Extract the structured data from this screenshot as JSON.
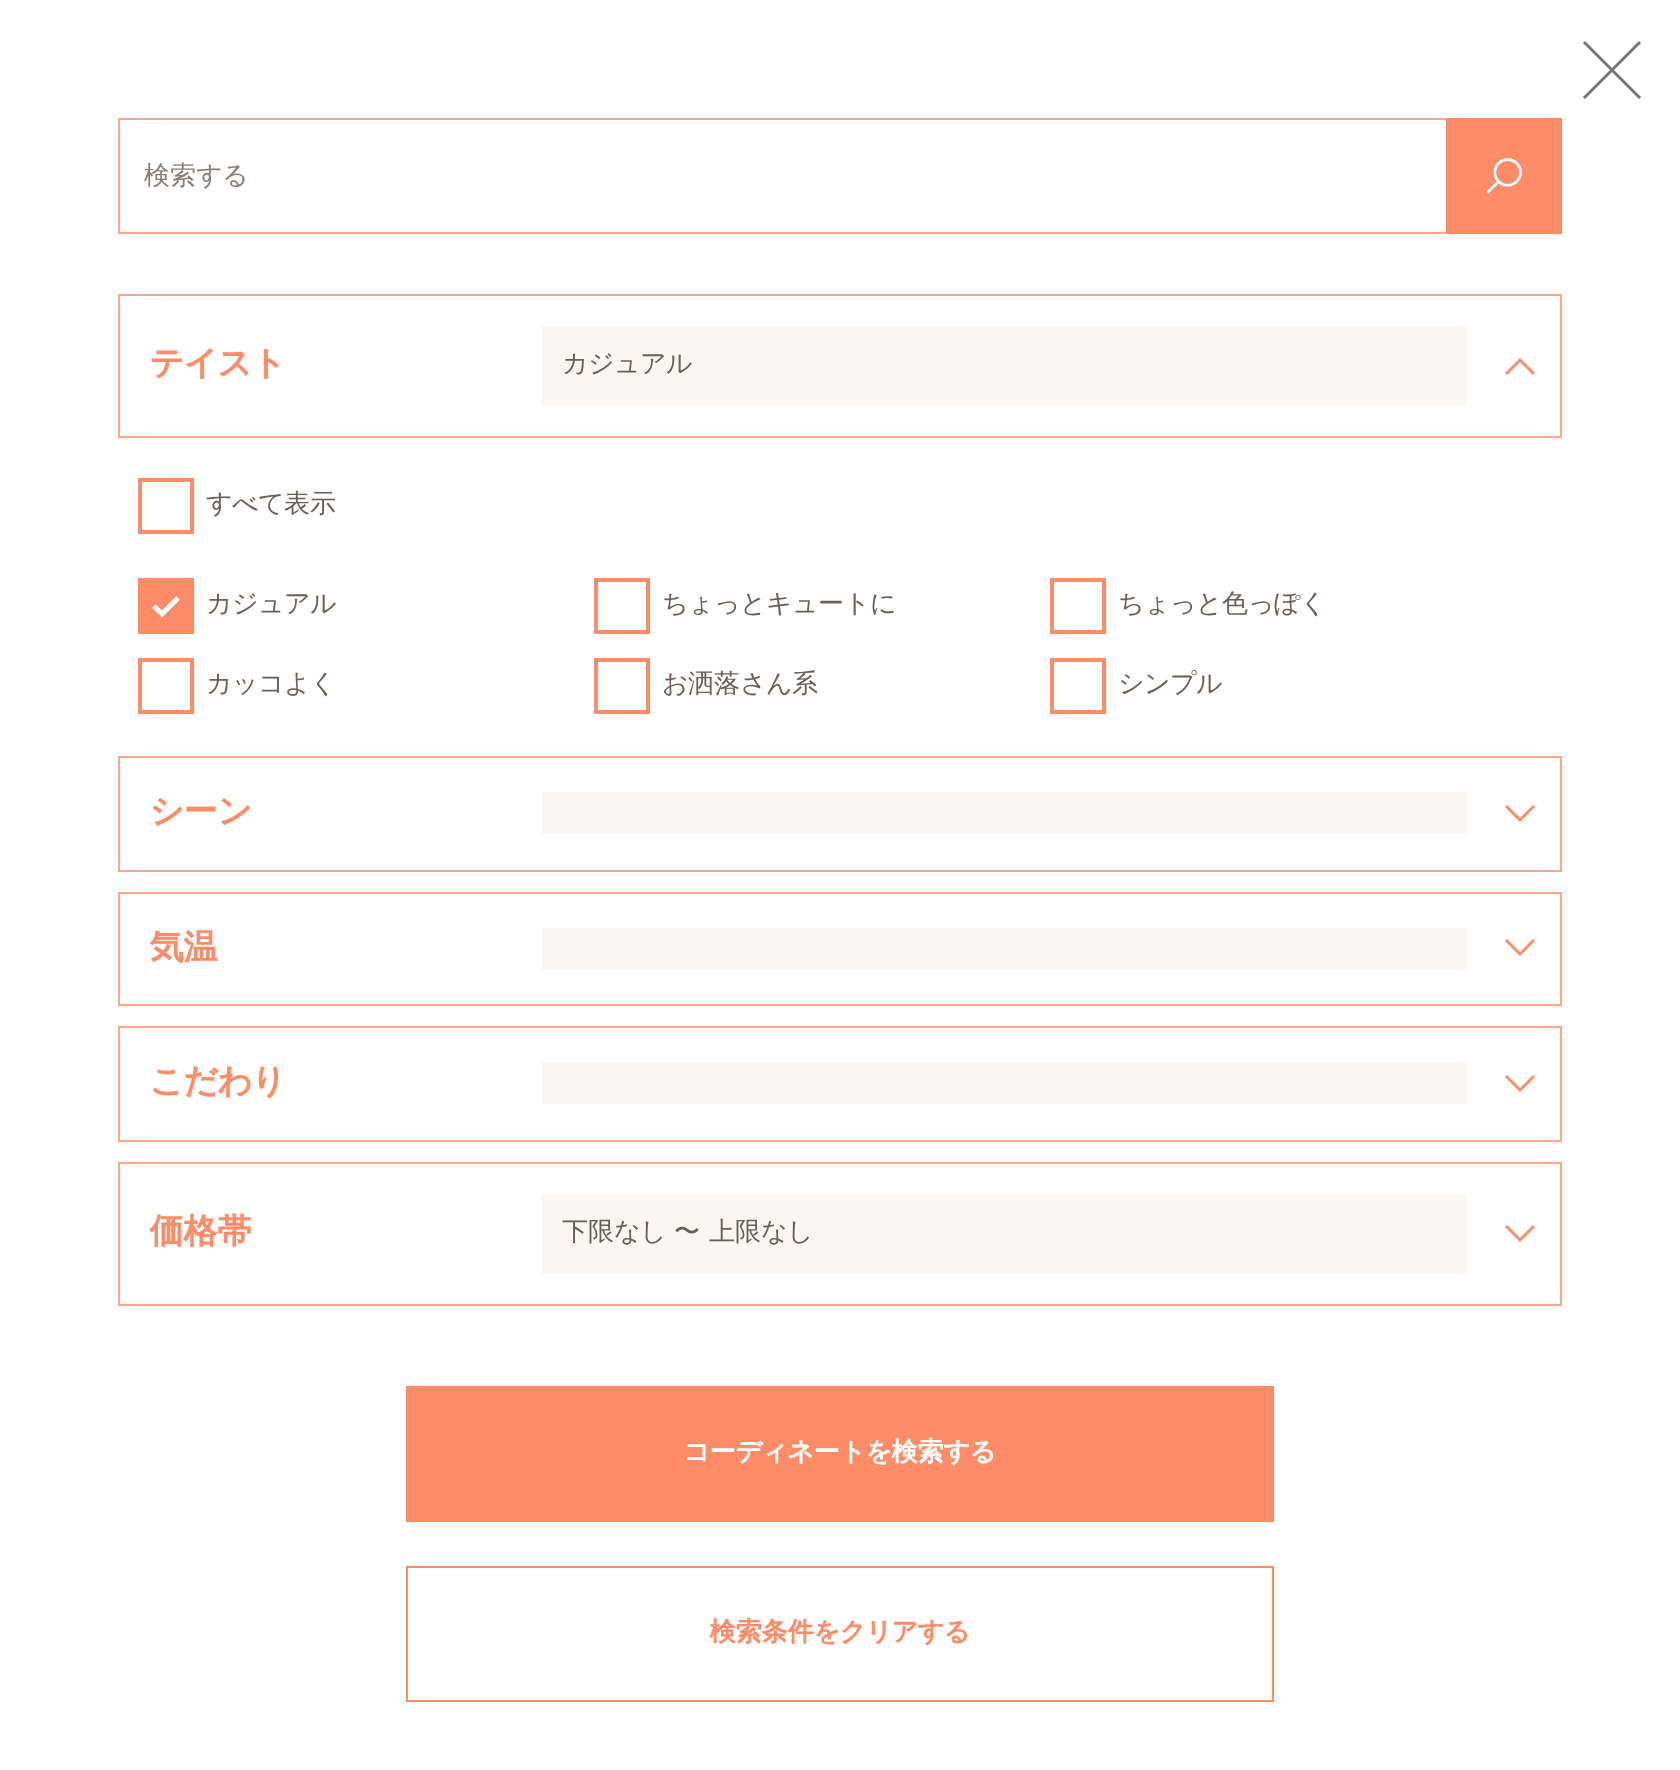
{
  "search": {
    "placeholder": "検索する"
  },
  "sections": [
    {
      "label": "テイスト",
      "value": "カジュアル",
      "expanded": true,
      "show_all": {
        "label": "すべて表示",
        "checked": false
      },
      "options": [
        {
          "label": "カジュアル",
          "checked": true
        },
        {
          "label": "ちょっとキュートに",
          "checked": false
        },
        {
          "label": "ちょっと色っぽく",
          "checked": false
        },
        {
          "label": "カッコよく",
          "checked": false
        },
        {
          "label": "お洒落さん系",
          "checked": false
        },
        {
          "label": "シンプル",
          "checked": false
        }
      ]
    },
    {
      "label": "シーン",
      "expanded": false
    },
    {
      "label": "気温",
      "expanded": false
    },
    {
      "label": "こだわり",
      "expanded": false
    },
    {
      "label": "価格帯",
      "value": "下限なし 〜 上限なし",
      "expanded": false
    }
  ],
  "buttons": [
    {
      "label": "コーディネートを検索する",
      "kind": "primary"
    },
    {
      "label": "検索条件をクリアする",
      "kind": "secondary"
    }
  ]
}
